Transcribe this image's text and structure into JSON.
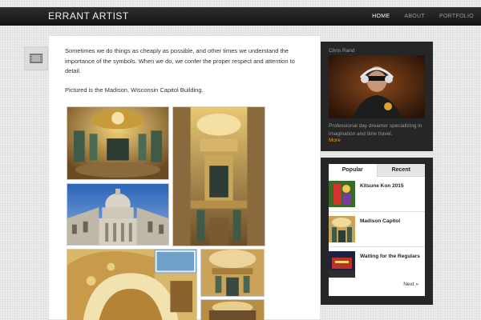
{
  "site": {
    "title": "ERRANT ARTIST"
  },
  "nav": {
    "items": [
      "HOME",
      "ABOUT",
      "PORTFOLIO"
    ],
    "active": "HOME"
  },
  "post": {
    "paragraphs": [
      "Sometimes we do things as cheaply as possible, and other times we understand the importance of the symbols. When we do, we confer the proper respect and attention to detail.",
      "Pictured is the Madison, Wisconsin Capitol Building."
    ],
    "icon": "gallery-icon"
  },
  "profile": {
    "name": "Chris Rand",
    "description": "Professional day dreamer specializing in imagination and time travel.",
    "more_label": "More"
  },
  "tabs": {
    "labels": [
      "Popular",
      "Recent"
    ],
    "active": "Popular",
    "posts": [
      {
        "title": "Kitsune Kon 2015"
      },
      {
        "title": "Madison Capitol"
      },
      {
        "title": "Waiting for the Regulars"
      }
    ],
    "next_label": "Next »"
  },
  "colors": {
    "accent": "#e69a2a",
    "topbar": "#1f1f1f",
    "sidebar": "#262626"
  }
}
